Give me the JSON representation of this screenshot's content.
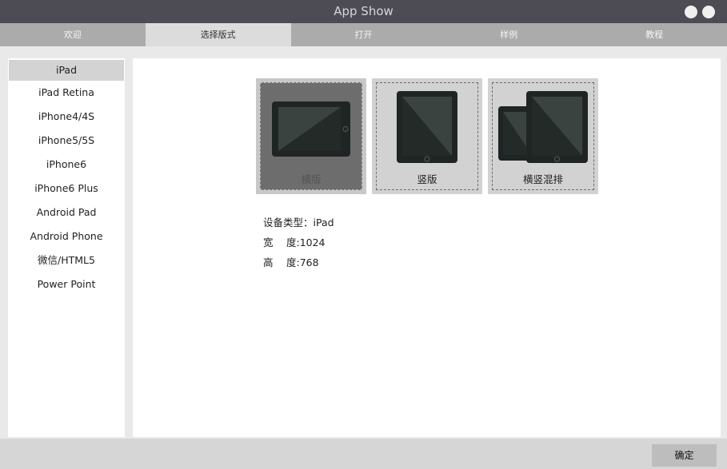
{
  "window": {
    "title": "App Show"
  },
  "tabs": [
    {
      "label": "欢迎"
    },
    {
      "label": "选择版式"
    },
    {
      "label": "打开"
    },
    {
      "label": "样例"
    },
    {
      "label": "教程"
    }
  ],
  "sidebar": {
    "items": [
      {
        "label": "iPad"
      },
      {
        "label": "iPad Retina"
      },
      {
        "label": "iPhone4/4S"
      },
      {
        "label": "iPhone5/5S"
      },
      {
        "label": "iPhone6"
      },
      {
        "label": "iPhone6 Plus"
      },
      {
        "label": "Android Pad"
      },
      {
        "label": "Android Phone"
      },
      {
        "label": "微信/HTML5"
      },
      {
        "label": "Power Point"
      }
    ]
  },
  "layouts": [
    {
      "label": "横版",
      "icon": "landscape-tablet-icon"
    },
    {
      "label": "竖版",
      "icon": "portrait-tablet-icon"
    },
    {
      "label": "横竖混排",
      "icon": "mixed-tablet-icon"
    }
  ],
  "device_info": {
    "type_label": "设备类型：",
    "type_value": "iPad",
    "width_label": "宽　 度:",
    "width_value": "1024",
    "height_label": "高　 度:",
    "height_value": "768"
  },
  "footer": {
    "ok_label": "确定"
  },
  "colors": {
    "titlebar": "#4d4c55",
    "tabbar": "#ababab",
    "tab_active": "#dcdcdc",
    "device_body": "#1f2524",
    "device_screen": "#3b4340"
  }
}
